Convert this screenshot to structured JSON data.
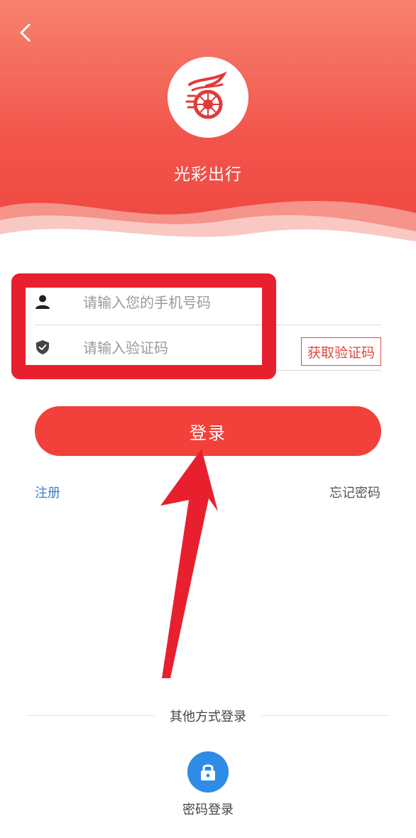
{
  "header": {
    "app_name": "光彩出行",
    "colors": {
      "top": "#f7836f",
      "bottom": "#ee463f"
    }
  },
  "form": {
    "phone_placeholder": "请输入您的手机号码",
    "code_placeholder": "请输入验证码",
    "get_code_label": "获取验证码",
    "login_label": "登录",
    "register_label": "注册",
    "forgot_label": "忘记密码"
  },
  "alt": {
    "divider_text": "其他方式登录",
    "password_login_label": "密码登录"
  },
  "icons": {
    "back": "chevron-left-icon",
    "logo": "dragon-wheel-logo",
    "user": "user-icon",
    "shield": "shield-icon",
    "lock": "lock-icon"
  },
  "colors": {
    "accent": "#f2403a",
    "link": "#3a7bd5",
    "annotation": "#e8202e",
    "lock_circle": "#2e8be6"
  }
}
